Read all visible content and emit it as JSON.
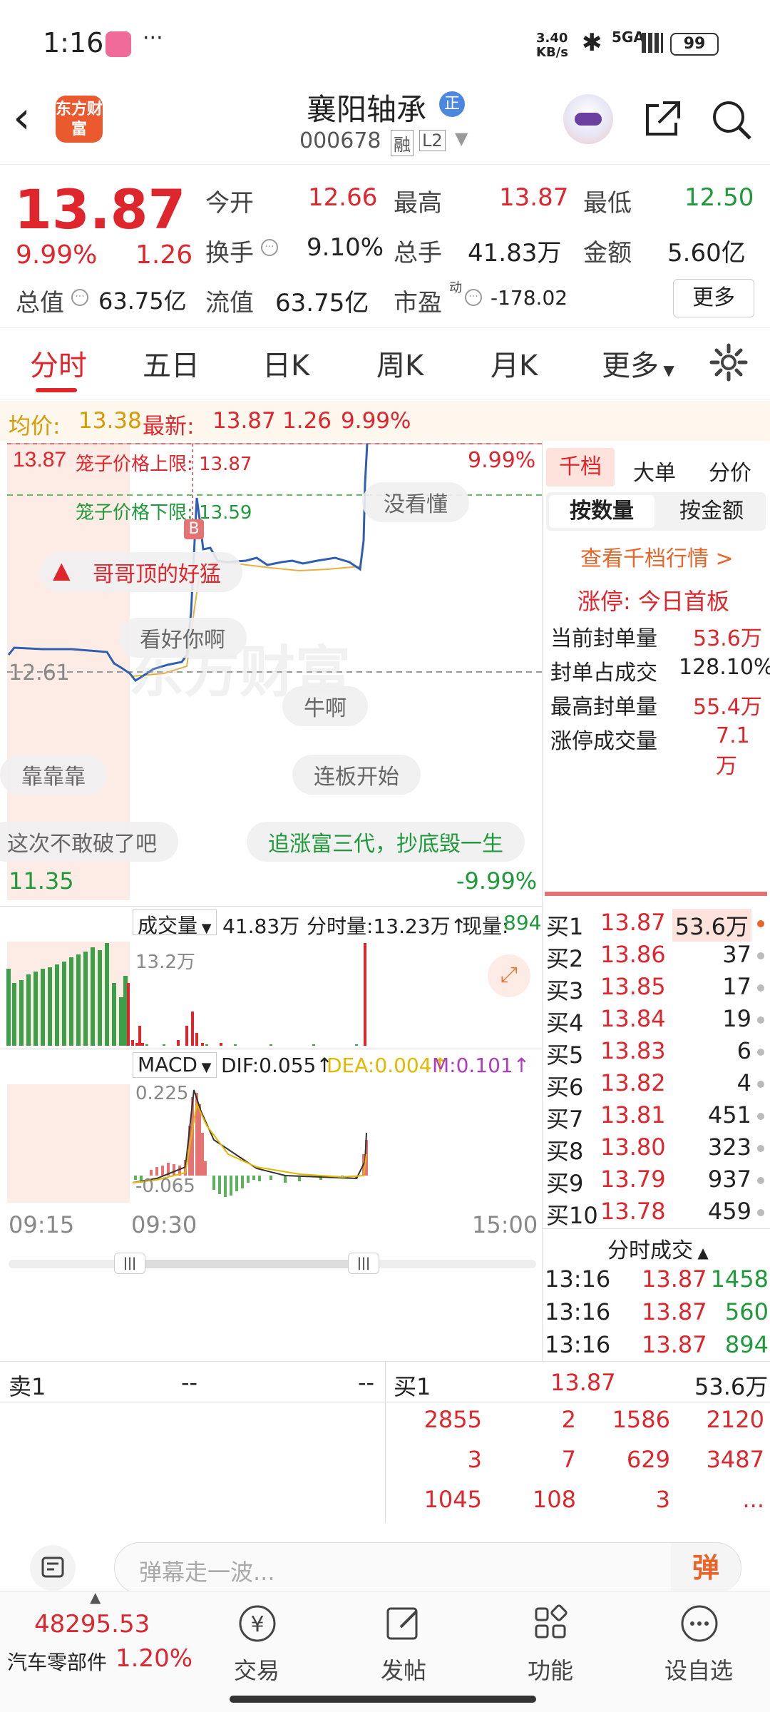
{
  "status": {
    "time": "1:16",
    "net_speed": "3.40 KB/s",
    "signal": "5GA",
    "battery": "99"
  },
  "header": {
    "logo": "东方财富",
    "name": "襄阳轴承",
    "badge": "正",
    "code": "000678",
    "tag1": "融",
    "tag2": "L2"
  },
  "quote": {
    "price": "13.87",
    "pct": "9.99%",
    "chg": "1.26",
    "open_label": "今开",
    "open": "12.66",
    "high_label": "最高",
    "high": "13.87",
    "low_label": "最低",
    "low": "12.50",
    "turnover_label": "换手",
    "turnover": "9.10%",
    "vol_label": "总手",
    "vol": "41.83万",
    "amt_label": "金额",
    "amt": "5.60亿",
    "mktcap_label": "总值",
    "mktcap": "63.75亿",
    "float_label": "流值",
    "float": "63.75亿",
    "pe_label": "市盈",
    "pe_sup": "动",
    "pe": "-178.02",
    "more": "更多"
  },
  "tabs": [
    "分时",
    "五日",
    "日K",
    "周K",
    "月K",
    "更多"
  ],
  "info": {
    "avg_label": "均价:",
    "avg": "13.38",
    "last_label": "最新:",
    "last": "13.87",
    "chg": "1.26",
    "pct": "9.99%"
  },
  "chart": {
    "top_price": "13.87",
    "top_pct": "9.99%",
    "bottom_price": "11.35",
    "bottom_pct": "-9.99%",
    "mid_price": "12.61",
    "cage_upper": "笼子价格上限: 13.87",
    "cage_lower": "笼子价格下限: 13.59",
    "marker": "B",
    "bubbles": [
      "没看懂",
      "哥哥顶的好猛",
      "看好你啊",
      "牛啊",
      "靠靠靠",
      "连板开始",
      "这次不敢破了吧",
      "追涨富三代，抄底毁一生"
    ],
    "vol_label": "成交量",
    "vol_total": "41.83万",
    "vol_min_label": "分时量:13.23万↑",
    "vol_now_label": "现量:",
    "vol_now": "894",
    "vol_axis": "13.2万",
    "macd_label": "MACD",
    "dif": "DIF:0.055↑",
    "dea": "DEA:0.004↑",
    "m": "M:0.101↑",
    "macd_top": "0.225",
    "macd_bottom": "-0.065",
    "time_axis": [
      "09:15",
      "09:30",
      "15:00"
    ],
    "watermark": "东方财富"
  },
  "side": {
    "tabs": [
      "千档",
      "大单",
      "分价"
    ],
    "subtabs": [
      "按数量",
      "按金额"
    ],
    "link": "查看千档行情 >",
    "limit_title": "涨停: 今日首板",
    "stats": [
      {
        "label": "当前封单量",
        "value": "53.6万"
      },
      {
        "label": "封单占成交",
        "value": "128.10%"
      },
      {
        "label": "最高封单量",
        "value": "55.4万"
      },
      {
        "label": "涨停成交量",
        "value": "7.1万"
      }
    ],
    "bids": [
      {
        "label": "买1",
        "price": "13.87",
        "vol": "53.6万"
      },
      {
        "label": "买2",
        "price": "13.86",
        "vol": "37"
      },
      {
        "label": "买3",
        "price": "13.85",
        "vol": "17"
      },
      {
        "label": "买4",
        "price": "13.84",
        "vol": "19"
      },
      {
        "label": "买5",
        "price": "13.83",
        "vol": "6"
      },
      {
        "label": "买6",
        "price": "13.82",
        "vol": "4"
      },
      {
        "label": "买7",
        "price": "13.81",
        "vol": "451"
      },
      {
        "label": "买8",
        "price": "13.80",
        "vol": "323"
      },
      {
        "label": "买9",
        "price": "13.79",
        "vol": "937"
      },
      {
        "label": "买10",
        "price": "13.78",
        "vol": "459"
      }
    ],
    "ticks_title": "分时成交",
    "ticks": [
      {
        "time": "13:16",
        "price": "13.87",
        "vol": "1458"
      },
      {
        "time": "13:16",
        "price": "13.87",
        "vol": "560"
      },
      {
        "time": "13:16",
        "price": "13.87",
        "vol": "894"
      }
    ]
  },
  "bottom": {
    "ask_label": "卖1",
    "ask_a": "--",
    "ask_b": "--",
    "bid_label": "买1",
    "bid_price": "13.87",
    "bid_vol": "53.6万",
    "rows": [
      [
        "2855",
        "2",
        "1586",
        "2120"
      ],
      [
        "3",
        "7",
        "629",
        "3487"
      ],
      [
        "1045",
        "108",
        "3",
        "..."
      ]
    ]
  },
  "input": {
    "placeholder": "弹幕走一波...",
    "danmu": "弹"
  },
  "nav": {
    "index": "48295.53",
    "sector": "汽车零部件",
    "sector_pct": "1.20%",
    "items": [
      "交易",
      "发帖",
      "功能",
      "设自选"
    ]
  }
}
